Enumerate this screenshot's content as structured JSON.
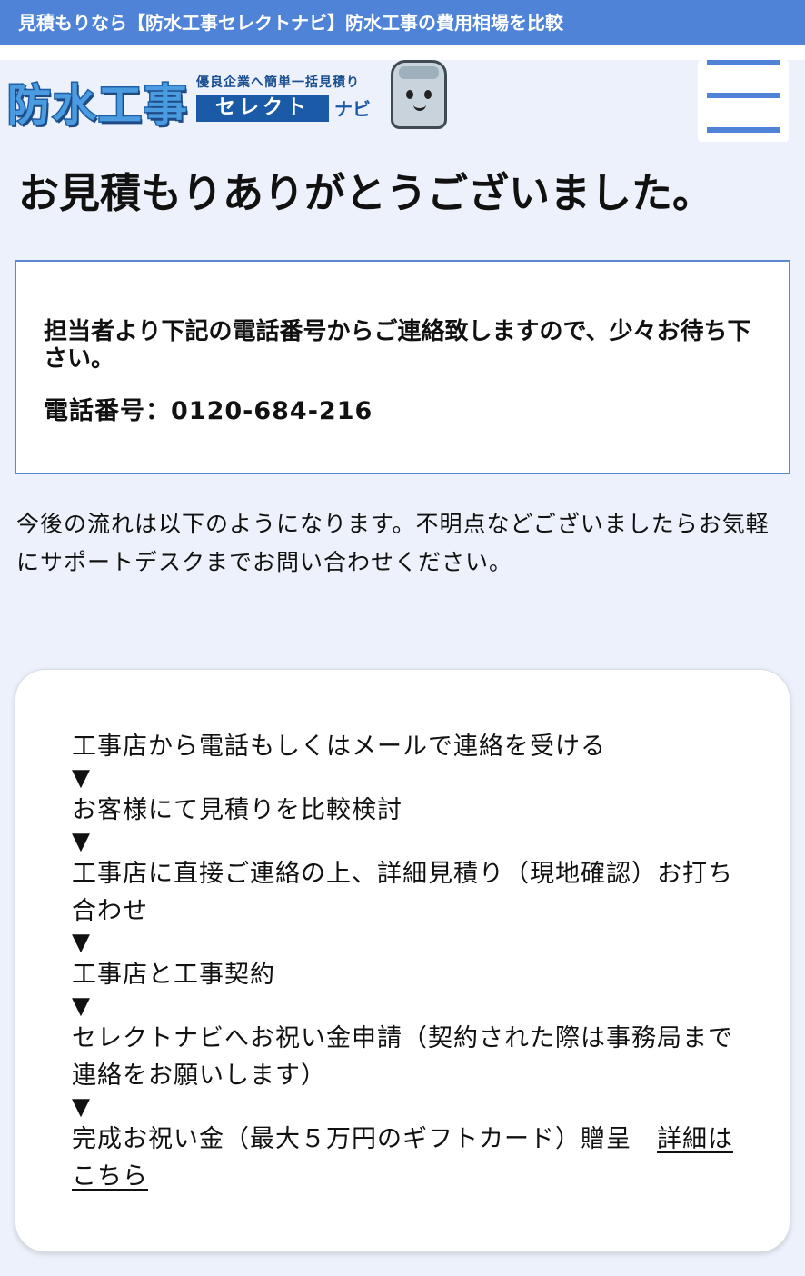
{
  "topbar": {
    "title": "見積もりなら【防水工事セレクトナビ】防水工事の費用相場を比較"
  },
  "header": {
    "logo_main": "防水工事",
    "logo_sub": "優良企業へ簡単一括見積り",
    "logo_brand": "セレクト",
    "logo_navi": "ナビ",
    "menu_icon": "hamburger-menu-icon"
  },
  "page": {
    "title": "お見積もりありがとうございました。"
  },
  "notice": {
    "message": "担当者より下記の電話番号からご連絡致しますので、少々お待ち下さい。",
    "phone": "電話番号：0120-684-216"
  },
  "flow": {
    "intro": "今後の流れは以下のようになります。不明点などございましたらお気軽にサポートデスクまでお問い合わせください。",
    "arrow": "▼",
    "steps": [
      "工事店から電話もしくはメールで連絡を受ける",
      "お客様にて見積りを比較検討",
      "工事店に直接ご連絡の上、詳細見積り（現地確認）お打ち合わせ",
      "工事店と工事契約",
      "セレクトナビへお祝い金申請（契約された際は事務局まで連絡をお願いします）",
      "完成お祝い金（最大５万円のギフトカード）贈呈　"
    ],
    "details_link": "詳細はこちら"
  },
  "colors": {
    "topbar": "#4f83d8",
    "background": "#ecf1fb",
    "box_border": "#5b86d0"
  }
}
